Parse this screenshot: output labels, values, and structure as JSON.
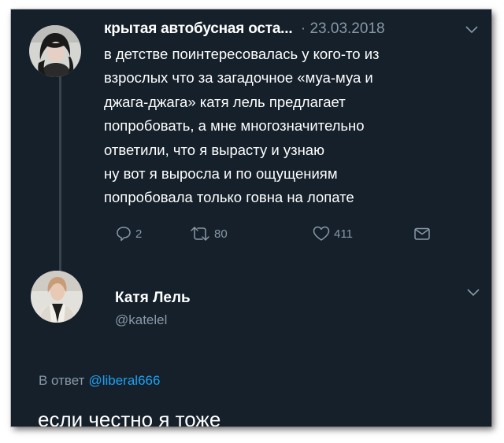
{
  "tweet1": {
    "author_name": "крытая автобусная оста...",
    "date": "· 23.03.2018",
    "text_lines": [
      "в детстве поинтересовалась у кого-то из",
      "взрослых что за загадочное «муа-муа и",
      "джага-джага» катя лель предлагает",
      "попробовать, а мне многозначительно",
      "ответили, что я вырасту и узнаю",
      "ну вот я выросла и по ощущениям",
      "попробовала только говна на лопате"
    ],
    "actions": {
      "reply_icon": "reply-icon",
      "reply_count": "2",
      "retweet_icon": "retweet-icon",
      "retweet_count": "80",
      "like_icon": "heart-icon",
      "like_count": "411",
      "dm_icon": "envelope-icon"
    }
  },
  "tweet2": {
    "author_name": "Катя Лель",
    "handle": "@katelel",
    "reply_prefix": "В ответ",
    "reply_mention": "@liberal666",
    "text": "если честно я тоже"
  },
  "colors": {
    "background": "#15202b",
    "text_primary": "#ffffff",
    "text_secondary": "#8899a6",
    "accent": "#1da1f2",
    "thread_line": "#38444d"
  }
}
